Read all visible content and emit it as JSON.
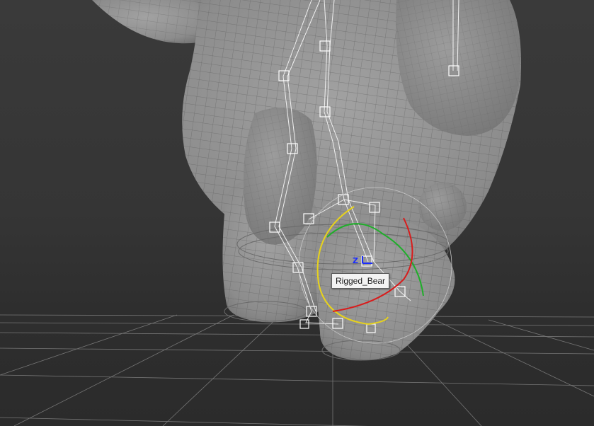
{
  "viewport": {
    "selected_object_label": "Rigged_Bear",
    "gizmo_axis_label": "Z"
  },
  "colors": {
    "mesh_fill": "#8a8a8a",
    "mesh_wire": "#5a5a5a",
    "bone": "#f0f0f0",
    "gizmo_x": "#d81c1c",
    "gizmo_y": "#1fae2a",
    "gizmo_z": "#1a2cff",
    "gizmo_screen": "#e7d21c",
    "grid": "#9a9a9a"
  }
}
